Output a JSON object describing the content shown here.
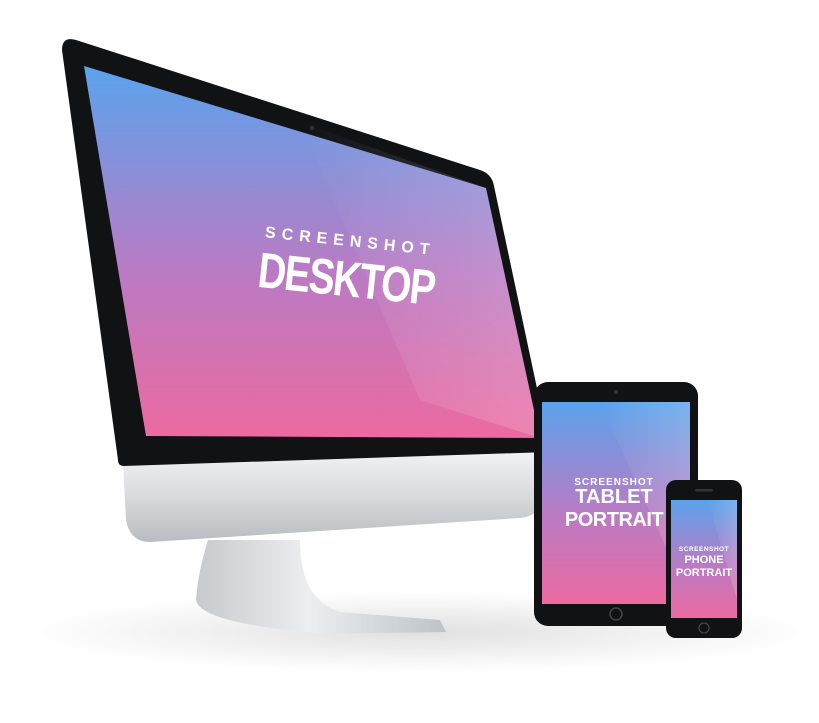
{
  "devices": {
    "desktop": {
      "label_small": "SCREENSHOT",
      "label_large": "DESKTOP"
    },
    "tablet": {
      "label_small": "SCREENSHOT",
      "label_line1": "TABLET",
      "label_line2": "PORTRAIT"
    },
    "phone": {
      "label_small": "SCREENSHOT",
      "label_line1": "PHONE",
      "label_line2": "PORTRAIT"
    }
  },
  "colors": {
    "gradient_top": "#5aa3ec",
    "gradient_bottom": "#ec6aa0",
    "bezel": "#111214",
    "aluminum": "#d9dbde"
  }
}
